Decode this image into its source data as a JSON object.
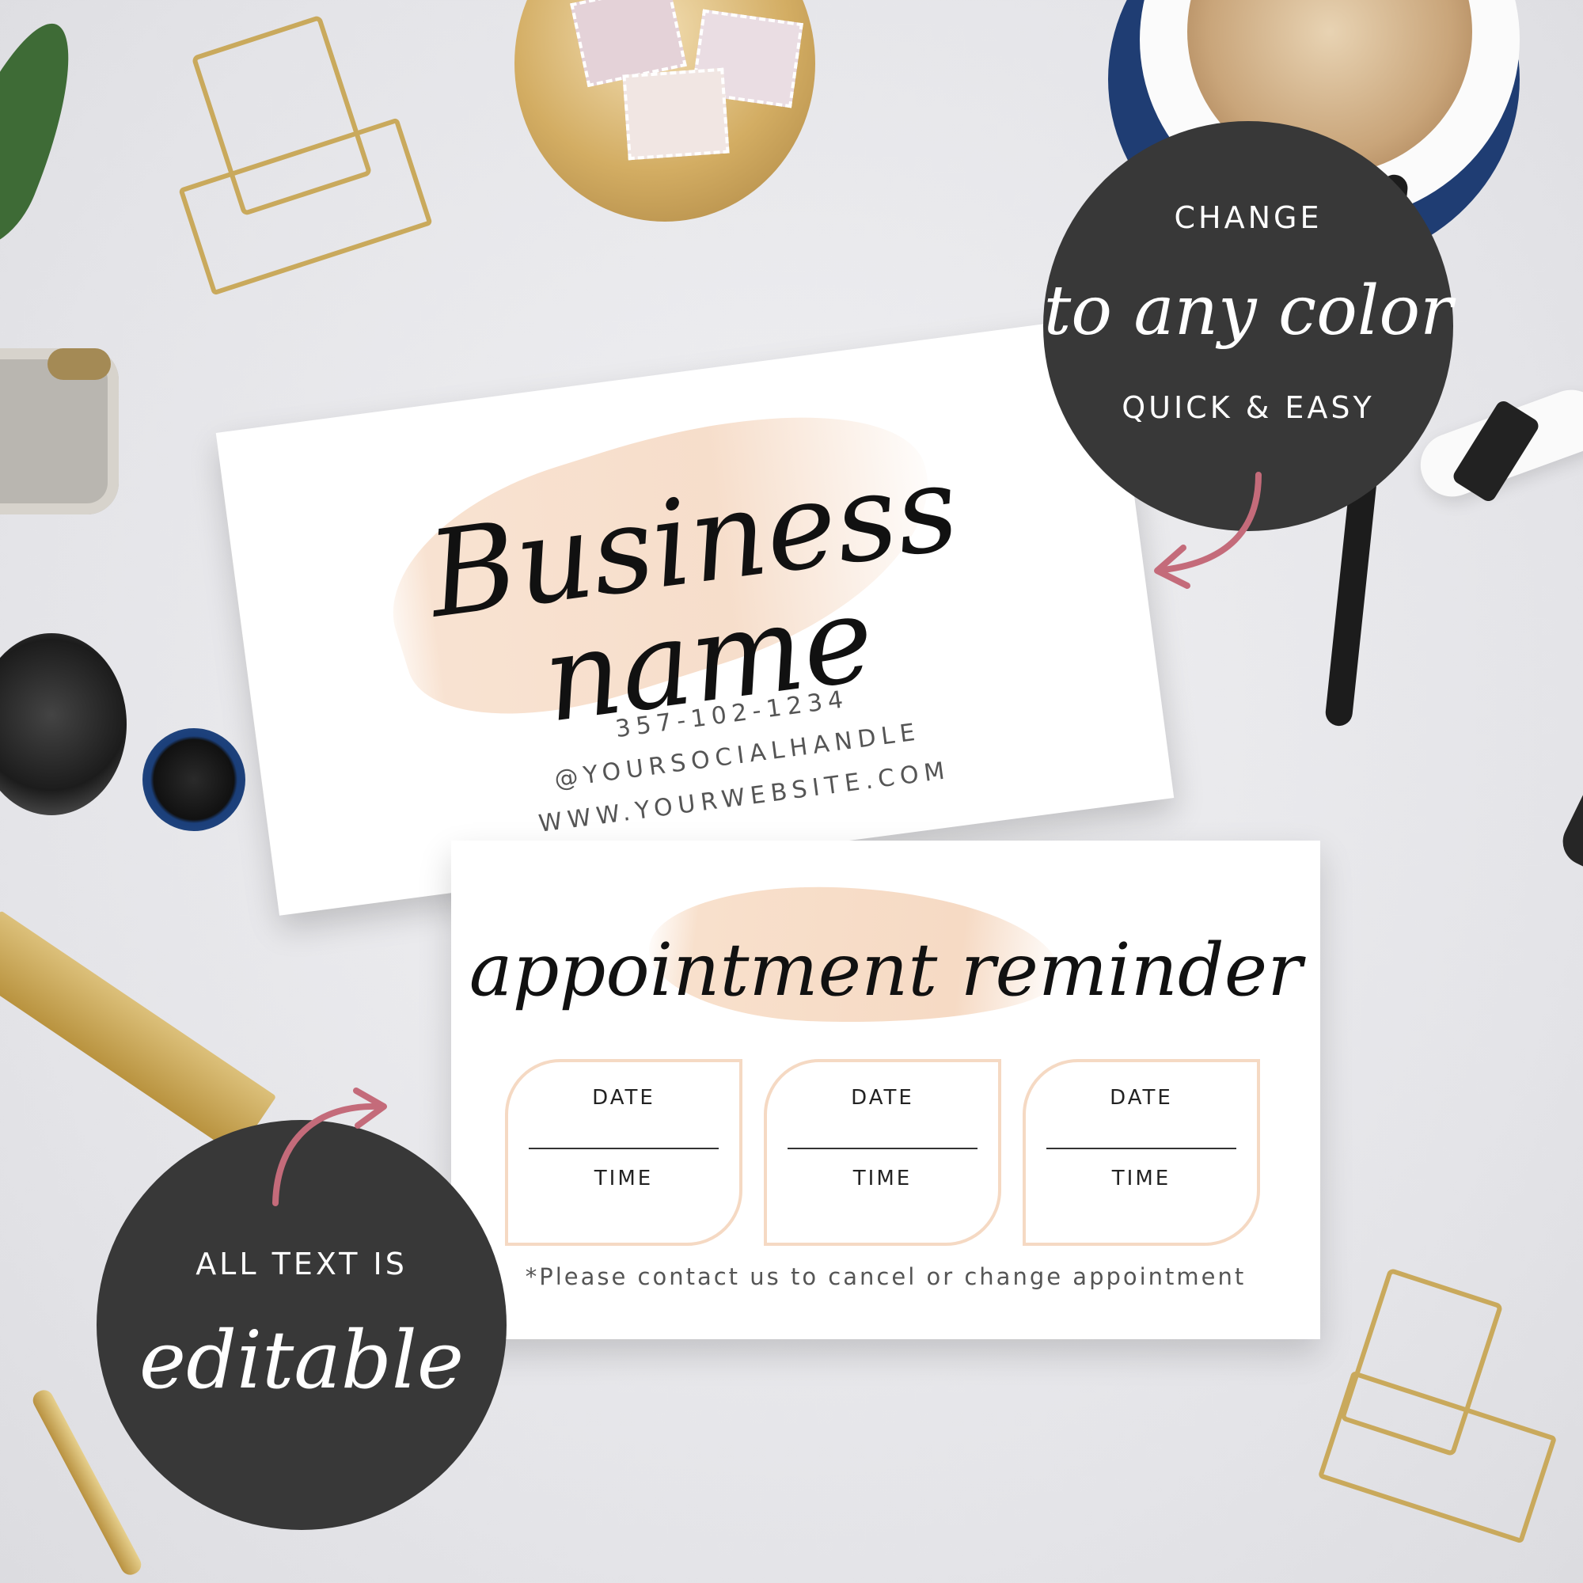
{
  "business_card": {
    "name": "Business name",
    "phone": "357-102-1234",
    "social": "@YOURSOCIALHANDLE",
    "website": "WWW.YOURWEBSITE.COM"
  },
  "reminder_card": {
    "title": "appointment reminder",
    "slots": [
      {
        "date": "DATE",
        "time": "TIME"
      },
      {
        "date": "DATE",
        "time": "TIME"
      },
      {
        "date": "DATE",
        "time": "TIME"
      }
    ],
    "note": "*Please contact us to cancel or change appointment"
  },
  "badges": {
    "color_badge": {
      "top": "CHANGE",
      "middle": "to any color",
      "bottom": "QUICK & EASY"
    },
    "edit_badge": {
      "top": "ALL TEXT IS",
      "middle": "editable"
    }
  },
  "colors": {
    "badge": "#383838",
    "brush": "#f7dcc8",
    "arrow": "#c46b7a",
    "slot_border": "#f5d9c3"
  }
}
